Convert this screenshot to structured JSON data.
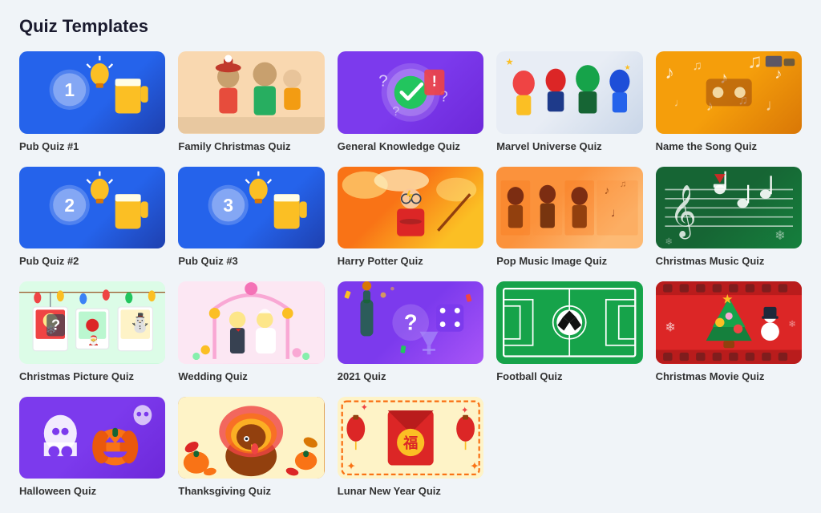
{
  "page": {
    "title": "Quiz Templates"
  },
  "cards": [
    {
      "id": "pub1",
      "label": "Pub Quiz #1",
      "thumb_class": "thumb-pub1"
    },
    {
      "id": "xmas-family",
      "label": "Family Christmas Quiz",
      "thumb_class": "thumb-xmas-family"
    },
    {
      "id": "general",
      "label": "General Knowledge Quiz",
      "thumb_class": "thumb-general"
    },
    {
      "id": "marvel",
      "label": "Marvel Universe Quiz",
      "thumb_class": "thumb-marvel"
    },
    {
      "id": "song",
      "label": "Name the Song Quiz",
      "thumb_class": "thumb-song"
    },
    {
      "id": "pub2",
      "label": "Pub Quiz #2",
      "thumb_class": "thumb-pub2"
    },
    {
      "id": "pub3",
      "label": "Pub Quiz #3",
      "thumb_class": "thumb-pub3"
    },
    {
      "id": "harry",
      "label": "Harry Potter Quiz",
      "thumb_class": "thumb-harry"
    },
    {
      "id": "pop",
      "label": "Pop Music Image Quiz",
      "thumb_class": "thumb-pop"
    },
    {
      "id": "xmas-music",
      "label": "Christmas Music Quiz",
      "thumb_class": "thumb-xmas-music"
    },
    {
      "id": "xmas-pic",
      "label": "Christmas Picture Quiz",
      "thumb_class": "thumb-xmas-pic"
    },
    {
      "id": "wedding",
      "label": "Wedding Quiz",
      "thumb_class": "thumb-wedding"
    },
    {
      "id": "2021",
      "label": "2021 Quiz",
      "thumb_class": "thumb-2021"
    },
    {
      "id": "football",
      "label": "Football Quiz",
      "thumb_class": "thumb-football"
    },
    {
      "id": "xmas-movie",
      "label": "Christmas Movie Quiz",
      "thumb_class": "thumb-xmas-movie"
    },
    {
      "id": "halloween",
      "label": "Halloween Quiz",
      "thumb_class": "thumb-halloween"
    },
    {
      "id": "thanksgiving",
      "label": "Thanksgiving Quiz",
      "thumb_class": "thumb-thanksgiving"
    },
    {
      "id": "lunar",
      "label": "Lunar New Year Quiz",
      "thumb_class": "thumb-lunar"
    }
  ]
}
